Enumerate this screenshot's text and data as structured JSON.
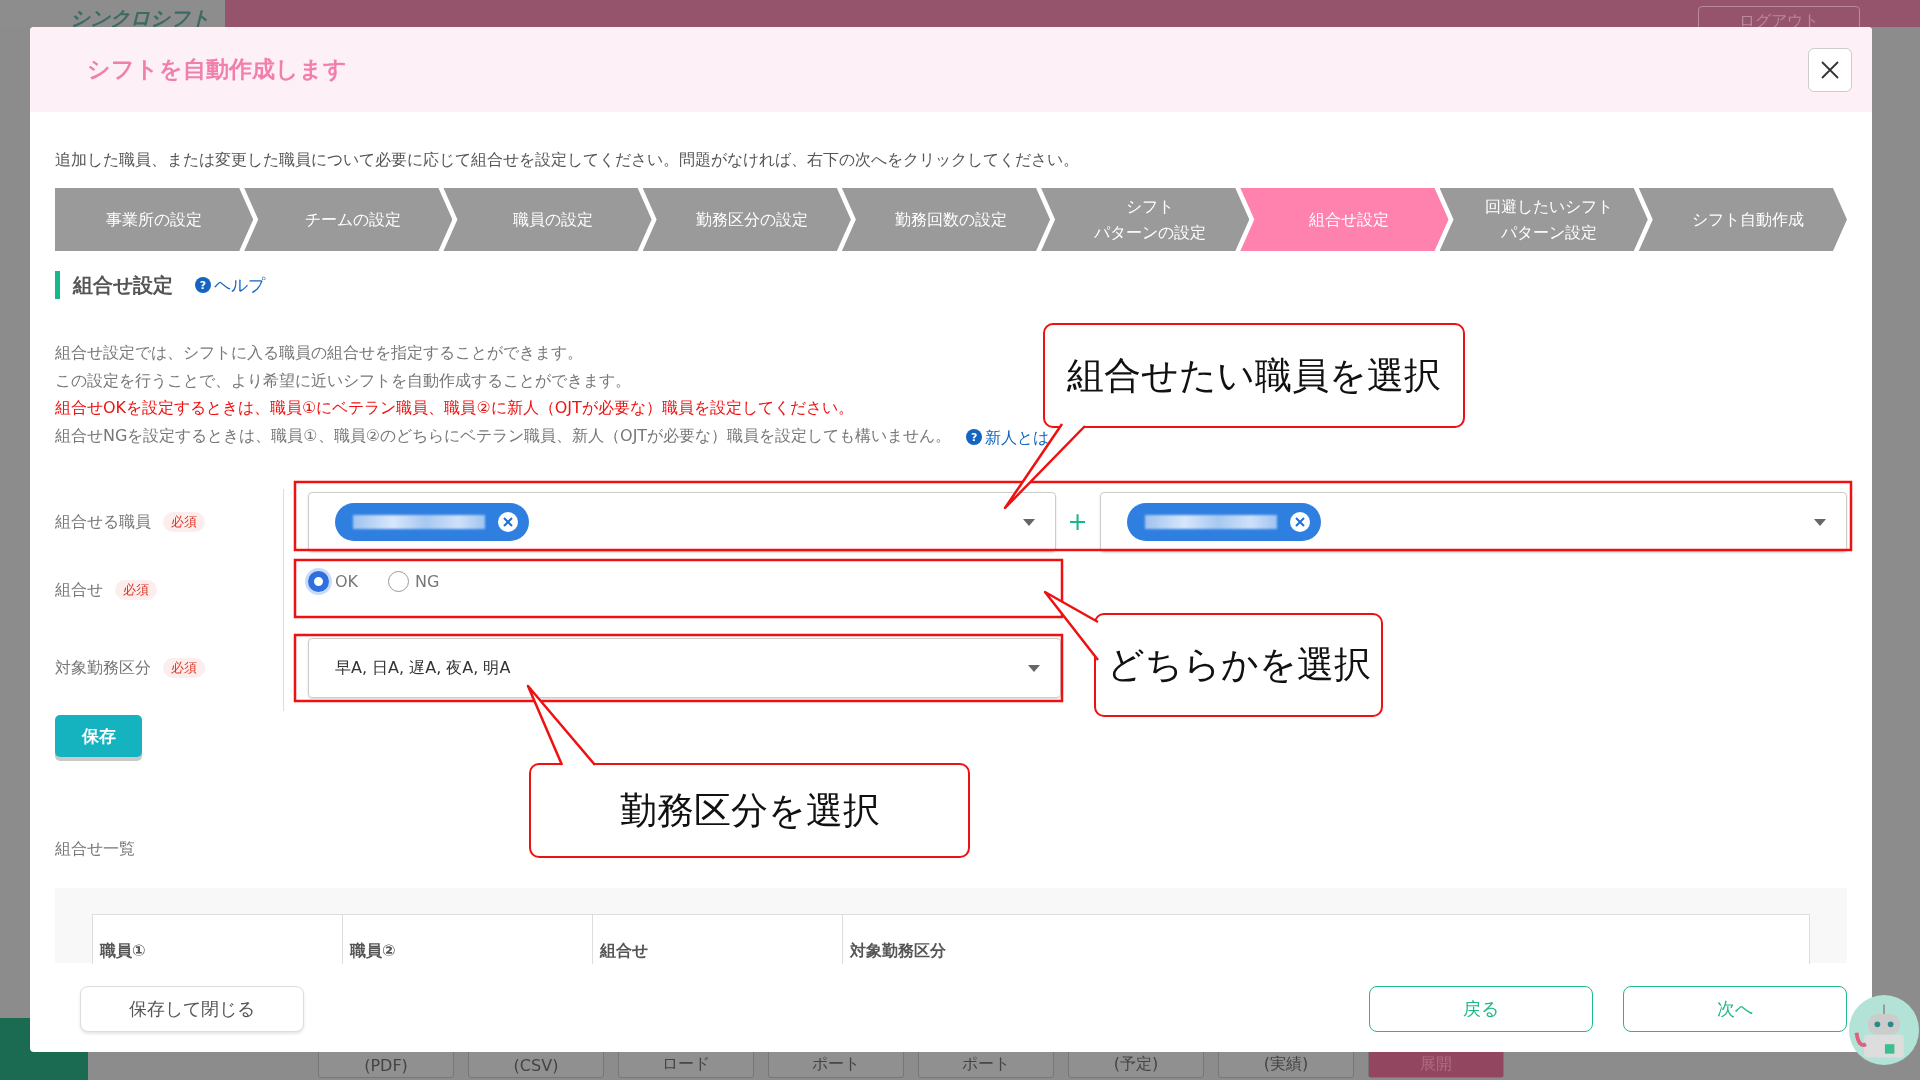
{
  "background": {
    "logo": "シンクロシフト",
    "logout": "ログアウト",
    "toolbar_buttons": [
      "(PDF)",
      "(CSV)",
      "ロード",
      "ポート",
      "ポート",
      "(予定)",
      "(実績)",
      "展開"
    ]
  },
  "dialog": {
    "title": "シフトを自動作成します",
    "intro": "追加した職員、または変更した職員について必要に応じて組合せを設定してください。問題がなければ、右下の次へをクリックしてください。",
    "steps": [
      {
        "label": "事業所の設定",
        "selected": false
      },
      {
        "label": "チームの設定",
        "selected": false
      },
      {
        "label": "職員の設定",
        "selected": false
      },
      {
        "label": "勤務区分の設定",
        "selected": false
      },
      {
        "label": "勤務回数の設定",
        "selected": false
      },
      {
        "lines": [
          "シフト",
          "パターンの設定"
        ],
        "selected": false
      },
      {
        "label": "組合せ設定",
        "selected": true
      },
      {
        "lines": [
          "回避したいシフト",
          "パターン設定"
        ],
        "selected": false
      },
      {
        "label": "シフト自動作成",
        "selected": false
      }
    ],
    "section_title": "組合せ設定",
    "help_icon": "?",
    "help_link": "ヘルプ",
    "description": [
      {
        "text": "組合せ設定では、シフトに入る職員の組合せを指定することができます。",
        "kind": "normal"
      },
      {
        "text": "この設定を行うことで、より希望に近いシフトを自動作成することができます。",
        "kind": "normal"
      },
      {
        "text": "組合せOKを設定するときは、職員①にベテラン職員、職員②に新人（OJTが必要な）職員を設定してください。",
        "kind": "warning"
      },
      {
        "text": "組合せNGを設定するときは、職員①、職員②のどちらにベテラン職員、新人（OJTが必要な）職員を設定しても構いません。",
        "kind": "normal"
      }
    ],
    "newcomer_icon": "?",
    "newcomer_link": "新人とは",
    "form": {
      "staff_label": "組合せる職員",
      "staff_required": "必須",
      "staff_selects": [
        {
          "has_chip": true
        },
        {
          "has_chip": true
        }
      ],
      "plus": "+",
      "combo_label": "組合せ",
      "combo_required": "必須",
      "combo_options": [
        {
          "label": "OK",
          "selected": true
        },
        {
          "label": "NG",
          "selected": false
        }
      ],
      "shift_label": "対象勤務区分",
      "shift_required": "必須",
      "shift_value": "早A, 日A, 遅A, 夜A, 明A"
    },
    "save_button": "保存",
    "list_title": "組合せ一覧",
    "table": {
      "columns": [
        "職員①",
        "職員②",
        "組合せ",
        "対象勤務区分"
      ]
    },
    "footer": {
      "save_close": "保存して閉じる",
      "back": "戻る",
      "next": "次へ"
    }
  },
  "callouts": [
    "組合せたい職員を選択",
    "どちらかを選択",
    "勤務区分を選択"
  ]
}
